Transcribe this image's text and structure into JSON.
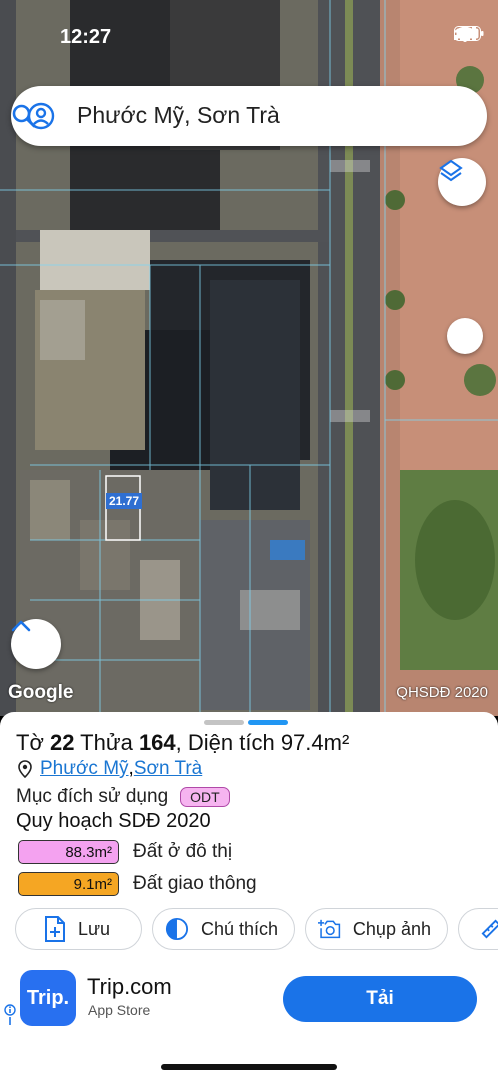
{
  "status": {
    "time": "12:27"
  },
  "search": {
    "query": "Phước Mỹ, Sơn Trà"
  },
  "map": {
    "measure_label": "21.77",
    "provider_logo": "Google",
    "layer_caption": "QHSDĐ 2020"
  },
  "parcel": {
    "title_prefix": "Tờ ",
    "sheet_no": "22",
    "title_mid": " Thửa ",
    "plot_no": "164",
    "title_area_prefix": ", Diện tích ",
    "area": "97.4m²",
    "ward": "Phước Mỹ",
    "separator": ", ",
    "district": "Sơn Trà",
    "purpose_label": "Mục đích sử dụng",
    "purpose_code": "ODT",
    "plan_title": "Quy hoạch SDĐ 2020",
    "zones": [
      {
        "area": "88.3m²",
        "label": "Đất ở đô thị",
        "color": "#f4a2f0"
      },
      {
        "area": "9.1m²",
        "label": "Đất giao thông",
        "color": "#f5a623"
      }
    ]
  },
  "actions": [
    {
      "label": "Lưu",
      "icon": "file-plus-icon"
    },
    {
      "label": "Chú thích",
      "icon": "contrast-icon"
    },
    {
      "label": "Chụp ảnh",
      "icon": "camera-plus-icon"
    },
    {
      "label": "",
      "icon": "ruler-icon"
    }
  ],
  "ad": {
    "logo_text": "Trip.",
    "title": "Trip.com",
    "subtitle": "App Store",
    "cta": "Tải"
  },
  "colors": {
    "accent": "#1a73e8",
    "handle_gray": "#c4c4c4",
    "handle_blue": "#2196f3"
  }
}
